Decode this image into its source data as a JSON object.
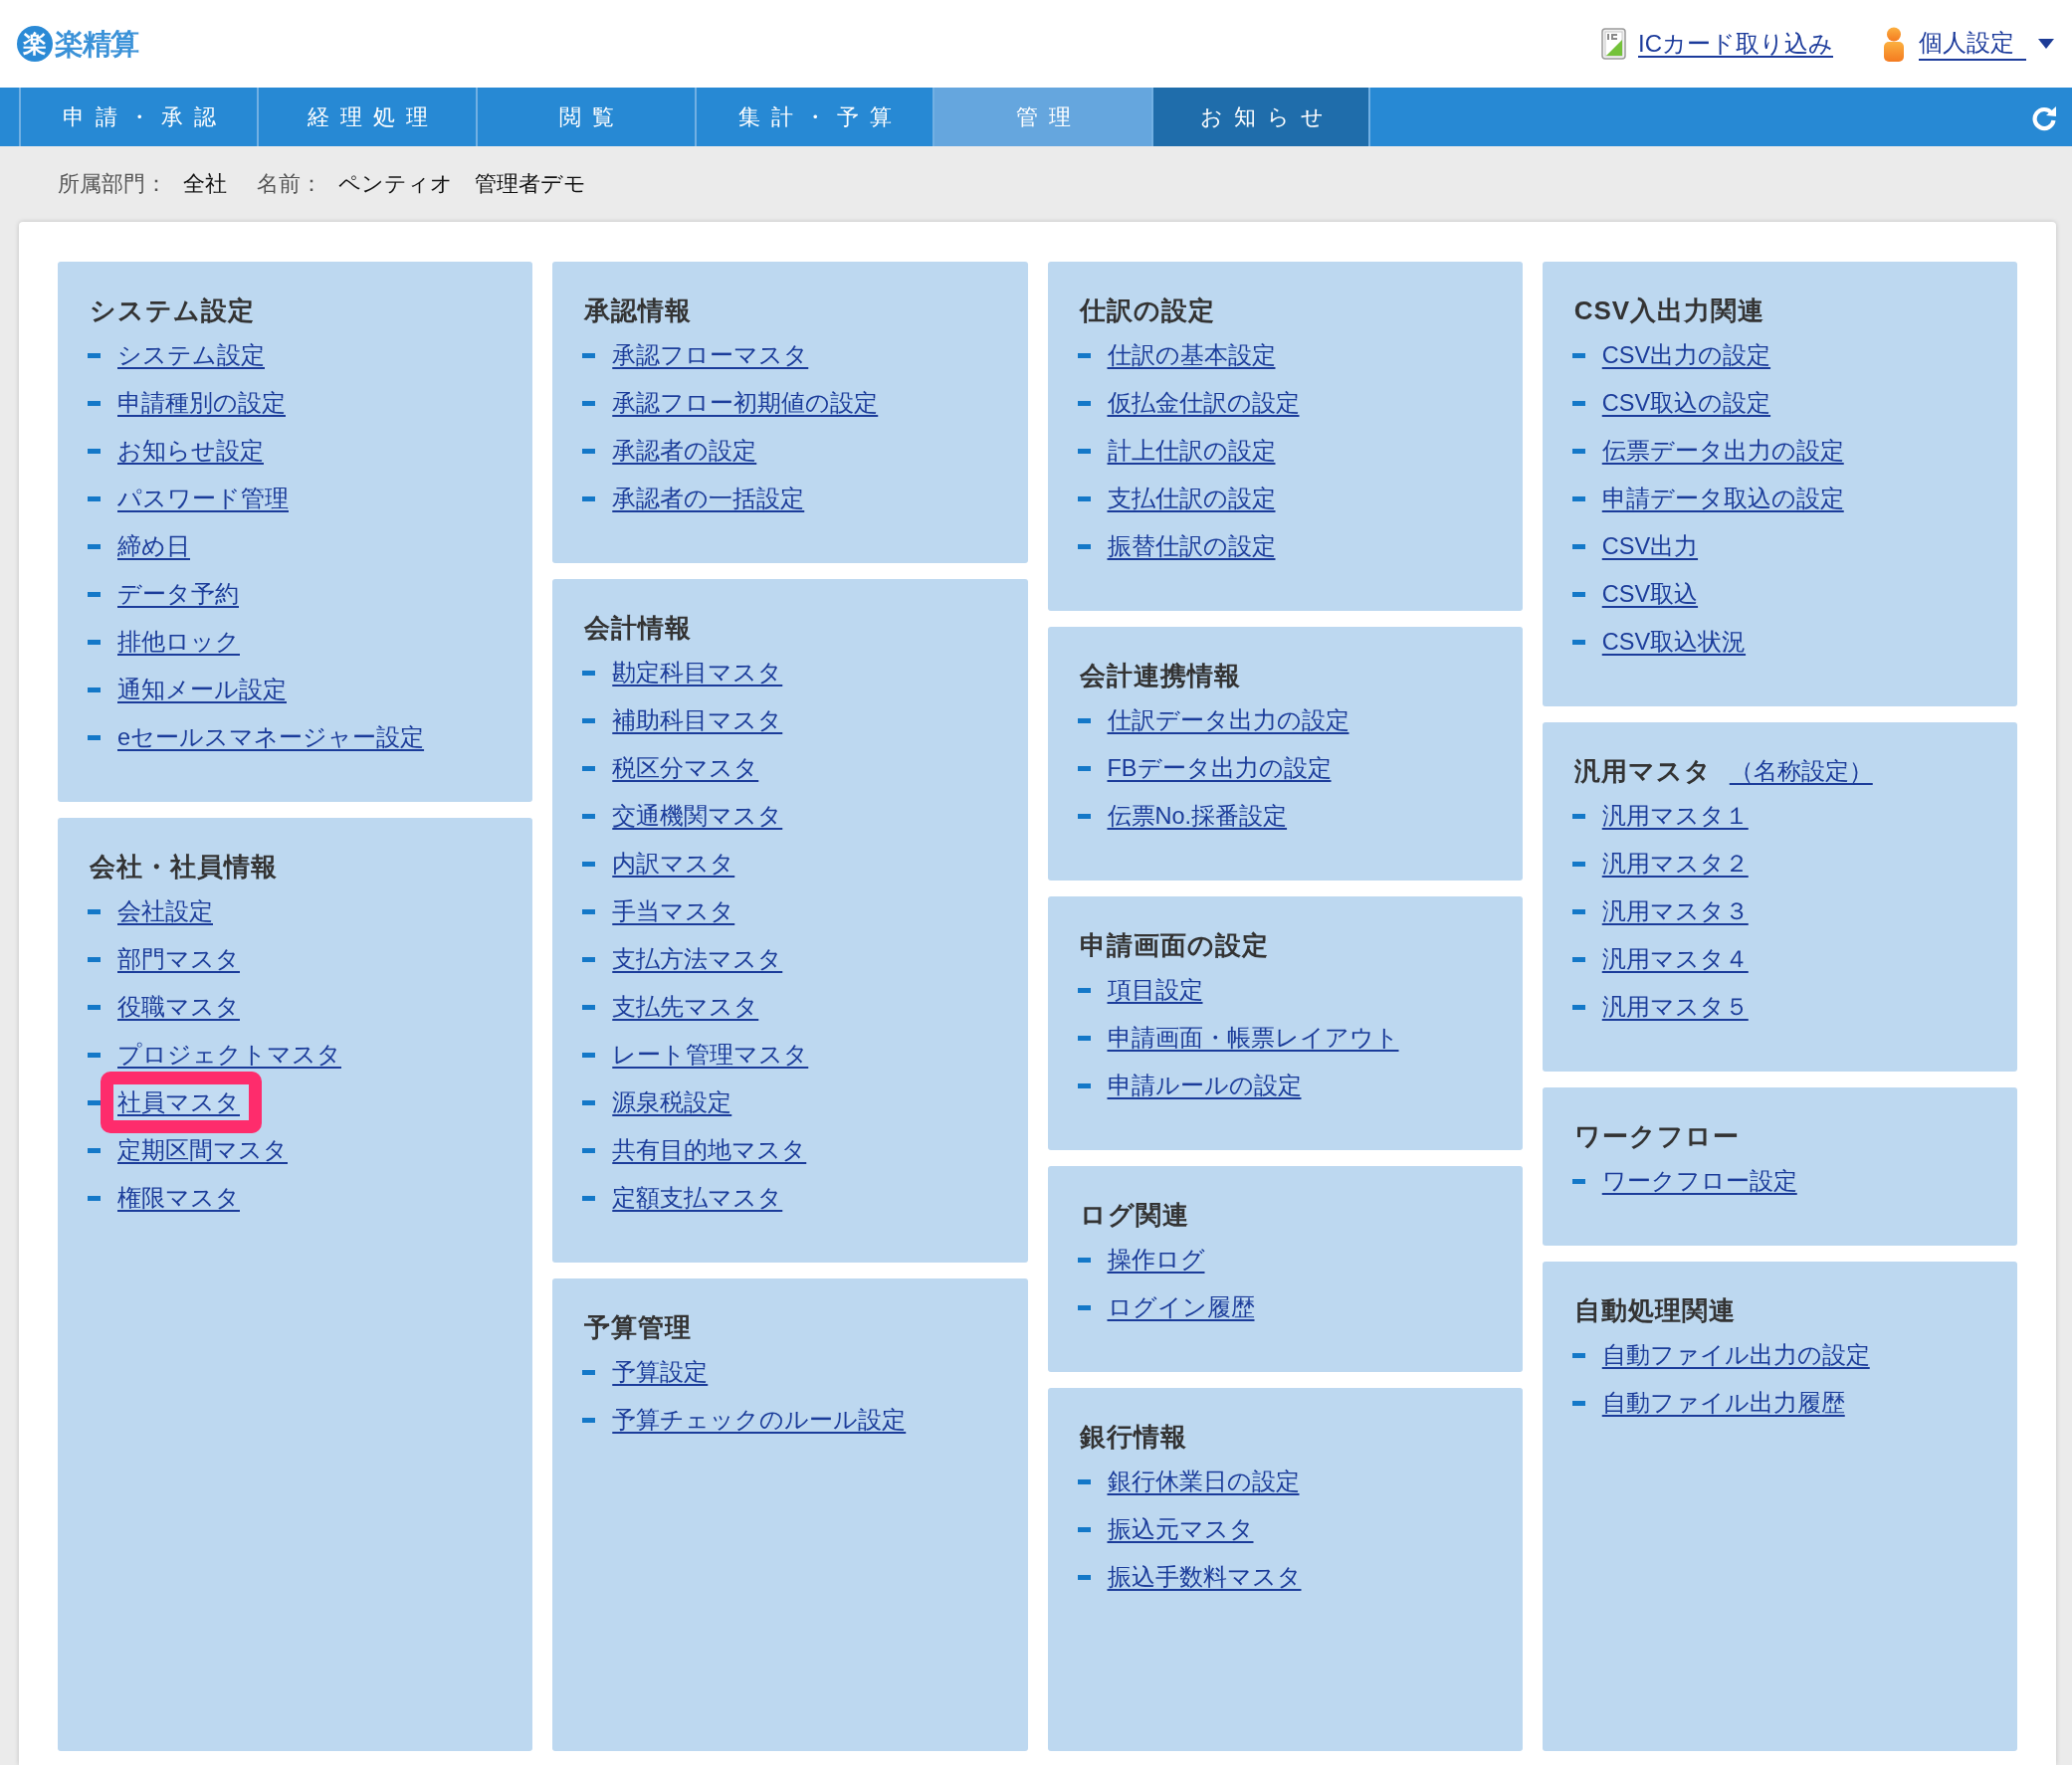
{
  "header": {
    "logo": {
      "mark": "楽",
      "text": "楽精算"
    },
    "ic_card_link": "ICカード取り込み",
    "user_menu": "個人設定"
  },
  "nav": {
    "tabs": [
      {
        "label": "申請・承認",
        "selected": false,
        "hovered": false
      },
      {
        "label": "経理処理",
        "selected": false,
        "hovered": false
      },
      {
        "label": "閲覧",
        "selected": false,
        "hovered": false
      },
      {
        "label": "集計・予算",
        "selected": false,
        "hovered": false
      },
      {
        "label": "管理",
        "selected": true,
        "hovered": false
      },
      {
        "label": "お知らせ",
        "selected": false,
        "hovered": true
      }
    ]
  },
  "user_info": {
    "department_label": "所属部門：",
    "department": "全社",
    "name_label": "名前：",
    "name": "ペンティオ　管理者デモ"
  },
  "columns": [
    {
      "panels": [
        {
          "title": "システム設定",
          "items": [
            {
              "label": "システム設定",
              "highlighted": false
            },
            {
              "label": "申請種別の設定",
              "highlighted": false
            },
            {
              "label": "お知らせ設定",
              "highlighted": false
            },
            {
              "label": "パスワード管理",
              "highlighted": false
            },
            {
              "label": "締め日",
              "highlighted": false
            },
            {
              "label": "データ予約",
              "highlighted": false
            },
            {
              "label": "排他ロック",
              "highlighted": false
            },
            {
              "label": "通知メール設定",
              "highlighted": false
            },
            {
              "label": "eセールスマネージャー設定",
              "highlighted": false
            }
          ]
        },
        {
          "title": "会社・社員情報",
          "items": [
            {
              "label": "会社設定",
              "highlighted": false
            },
            {
              "label": "部門マスタ",
              "highlighted": false
            },
            {
              "label": "役職マスタ",
              "highlighted": false
            },
            {
              "label": "プロジェクトマスタ",
              "highlighted": false
            },
            {
              "label": "社員マスタ",
              "highlighted": true
            },
            {
              "label": "定期区間マスタ",
              "highlighted": false
            },
            {
              "label": "権限マスタ",
              "highlighted": false
            }
          ]
        }
      ]
    },
    {
      "panels": [
        {
          "title": "承認情報",
          "items": [
            {
              "label": "承認フローマスタ",
              "highlighted": false
            },
            {
              "label": "承認フロー初期値の設定",
              "highlighted": false
            },
            {
              "label": "承認者の設定",
              "highlighted": false
            },
            {
              "label": "承認者の一括設定",
              "highlighted": false
            }
          ]
        },
        {
          "title": "会計情報",
          "items": [
            {
              "label": "勘定科目マスタ",
              "highlighted": false
            },
            {
              "label": "補助科目マスタ",
              "highlighted": false
            },
            {
              "label": "税区分マスタ",
              "highlighted": false
            },
            {
              "label": "交通機関マスタ",
              "highlighted": false
            },
            {
              "label": "内訳マスタ",
              "highlighted": false
            },
            {
              "label": "手当マスタ",
              "highlighted": false
            },
            {
              "label": "支払方法マスタ",
              "highlighted": false
            },
            {
              "label": "支払先マスタ",
              "highlighted": false
            },
            {
              "label": "レート管理マスタ",
              "highlighted": false
            },
            {
              "label": "源泉税設定",
              "highlighted": false
            },
            {
              "label": "共有目的地マスタ",
              "highlighted": false
            },
            {
              "label": "定額支払マスタ",
              "highlighted": false
            }
          ]
        },
        {
          "title": "予算管理",
          "items": [
            {
              "label": "予算設定",
              "highlighted": false
            },
            {
              "label": "予算チェックのルール設定",
              "highlighted": false
            }
          ]
        }
      ]
    },
    {
      "panels": [
        {
          "title": "仕訳の設定",
          "items": [
            {
              "label": "仕訳の基本設定",
              "highlighted": false
            },
            {
              "label": "仮払金仕訳の設定",
              "highlighted": false
            },
            {
              "label": "計上仕訳の設定",
              "highlighted": false
            },
            {
              "label": "支払仕訳の設定",
              "highlighted": false
            },
            {
              "label": "振替仕訳の設定",
              "highlighted": false
            }
          ]
        },
        {
          "title": "会計連携情報",
          "items": [
            {
              "label": "仕訳データ出力の設定",
              "highlighted": false
            },
            {
              "label": "FBデータ出力の設定",
              "highlighted": false
            },
            {
              "label": "伝票No.採番設定",
              "highlighted": false
            }
          ]
        },
        {
          "title": "申請画面の設定",
          "items": [
            {
              "label": "項目設定",
              "highlighted": false
            },
            {
              "label": "申請画面・帳票レイアウト",
              "highlighted": false
            },
            {
              "label": "申請ルールの設定",
              "highlighted": false
            }
          ]
        },
        {
          "title": "ログ関連",
          "items": [
            {
              "label": "操作ログ",
              "highlighted": false
            },
            {
              "label": "ログイン履歴",
              "highlighted": false
            }
          ]
        },
        {
          "title": "銀行情報",
          "items": [
            {
              "label": "銀行休業日の設定",
              "highlighted": false
            },
            {
              "label": "振込元マスタ",
              "highlighted": false
            },
            {
              "label": "振込手数料マスタ",
              "highlighted": false
            }
          ]
        }
      ]
    },
    {
      "panels": [
        {
          "title": "CSV入出力関連",
          "items": [
            {
              "label": "CSV出力の設定",
              "highlighted": false
            },
            {
              "label": "CSV取込の設定",
              "highlighted": false
            },
            {
              "label": "伝票データ出力の設定",
              "highlighted": false
            },
            {
              "label": "申請データ取込の設定",
              "highlighted": false
            },
            {
              "label": "CSV出力",
              "highlighted": false
            },
            {
              "label": "CSV取込",
              "highlighted": false
            },
            {
              "label": "CSV取込状況",
              "highlighted": false
            }
          ]
        },
        {
          "title": "汎用マスタ",
          "title_link": "（名称設定）",
          "items": [
            {
              "label": "汎用マスタ１",
              "highlighted": false
            },
            {
              "label": "汎用マスタ２",
              "highlighted": false
            },
            {
              "label": "汎用マスタ３",
              "highlighted": false
            },
            {
              "label": "汎用マスタ４",
              "highlighted": false
            },
            {
              "label": "汎用マスタ５",
              "highlighted": false
            }
          ]
        },
        {
          "title": "ワークフロー",
          "items": [
            {
              "label": "ワークフロー設定",
              "highlighted": false
            }
          ]
        },
        {
          "title": "自動処理関連",
          "items": [
            {
              "label": "自動ファイル出力の設定",
              "highlighted": false
            },
            {
              "label": "自動ファイル出力履歴",
              "highlighted": false
            }
          ]
        }
      ]
    }
  ]
}
